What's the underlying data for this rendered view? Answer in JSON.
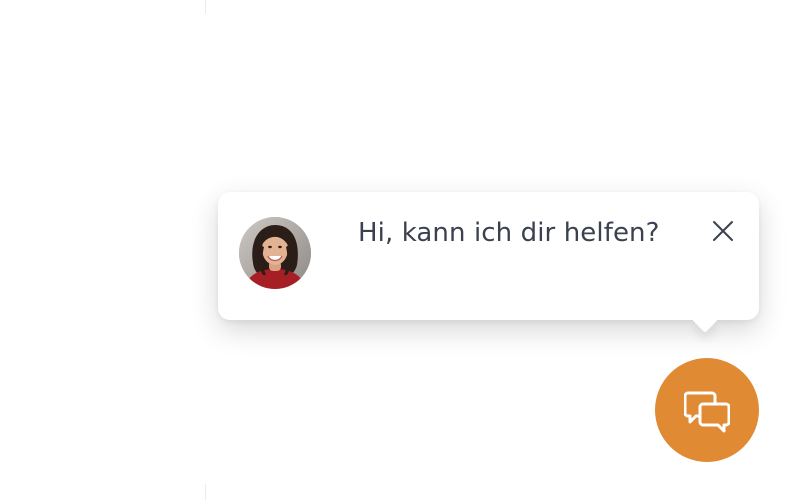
{
  "chat_widget": {
    "greeting": "Hi, kann ich dir helfen?",
    "avatar_icon": "agent-avatar",
    "close_icon": "close-icon",
    "launcher_icon": "chat-bubbles-icon",
    "accent_color": "#e08a33"
  }
}
